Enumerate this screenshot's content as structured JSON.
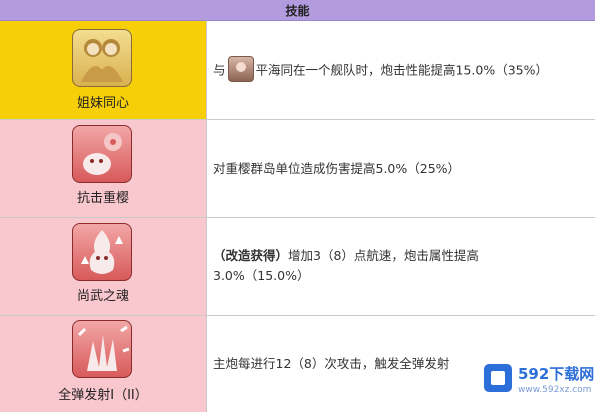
{
  "header": {
    "title": "技能"
  },
  "skills": [
    {
      "name": "姐妹同心",
      "desc_before": "与",
      "desc_after": "平海同在一个舰队时，炮击性能提高15.0%（35%）"
    },
    {
      "name": "抗击重樱",
      "desc": "对重樱群岛单位造成伤害提高5.0%（25%）"
    },
    {
      "name": "尚武之魂",
      "desc_bold": "（改造获得）",
      "desc_line1": "增加3（8）点航速，炮击属性提高",
      "desc_line2": "3.0%（15.0%）"
    },
    {
      "name": "全弹发射I（II）",
      "desc": "主炮每进行12（8）次攻击，触发全弹发射"
    }
  ],
  "watermark": {
    "title": "592下载网",
    "url": "www.592xz.com"
  },
  "icons": [
    "sisters-portrait-icon",
    "cherry-blossom-creature-icon",
    "spirit-flame-icon",
    "full-barrage-hand-icon",
    "character-avatar-icon"
  ],
  "colors": {
    "header": "#b39be0",
    "row_gold": "#f6cf08",
    "row_pink": "#f9c7ce",
    "watermark_blue": "#2d6fd8"
  }
}
